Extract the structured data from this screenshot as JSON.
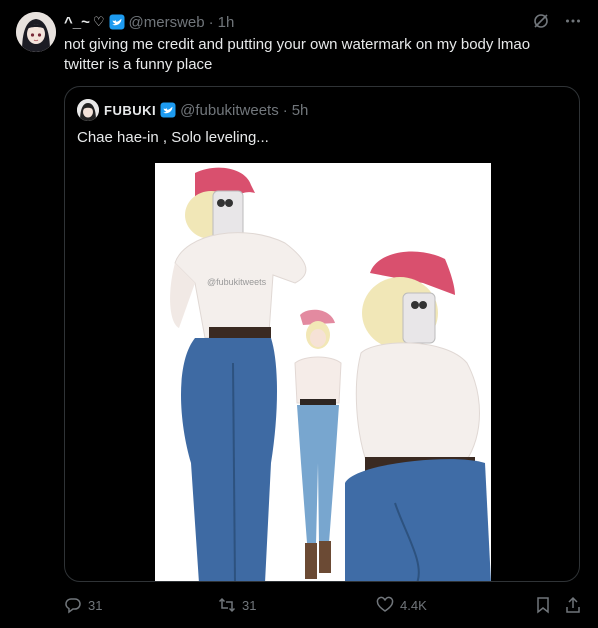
{
  "author": {
    "display_name": "^_~",
    "heart": "♡",
    "handle": "@mersweb",
    "time": "1h"
  },
  "tweet": {
    "lines": [
      "not giving me credit and putting your own watermark on my body lmao",
      "twitter is a funny place"
    ]
  },
  "quote": {
    "display_name": "FUBUKI",
    "handle": "@fubukitweets",
    "time": "5h",
    "text": "Chae hae-in , Solo leveling...",
    "watermark": "@fubukitweets"
  },
  "actions": {
    "replies": "31",
    "retweets": "31",
    "likes": "4.4K"
  },
  "colors": {
    "background": "#000000",
    "text": "#e7e9ea",
    "muted": "#71767b",
    "verified": "#1d9bf0",
    "border": "#2f3336"
  }
}
